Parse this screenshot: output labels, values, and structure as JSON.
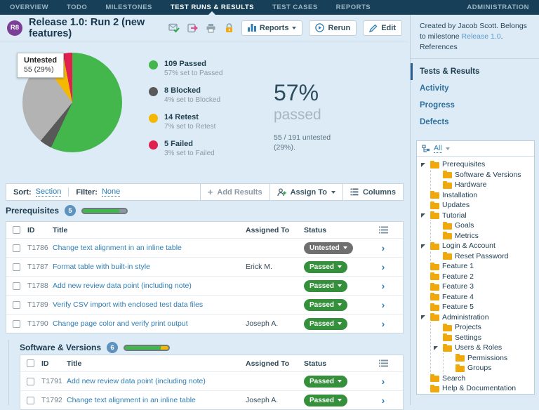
{
  "nav": {
    "items": [
      "OVERVIEW",
      "TODO",
      "MILESTONES",
      "TEST RUNS & RESULTS",
      "TEST CASES",
      "REPORTS"
    ],
    "active": "TEST RUNS & RESULTS",
    "right": "ADMINISTRATION"
  },
  "header": {
    "badge": "R8",
    "title": "Release 1.0: Run 2 (new features)",
    "reports_label": "Reports",
    "rerun_label": "Rerun",
    "edit_label": "Edit"
  },
  "chart_data": {
    "type": "pie",
    "slices": [
      {
        "label": "Passed",
        "count": 109,
        "pct": 57,
        "color": "#43b64c"
      },
      {
        "label": "Blocked",
        "count": 8,
        "pct": 4,
        "color": "#595959"
      },
      {
        "label": "Untested",
        "count": 55,
        "pct": 29,
        "color": "#b3b3b3"
      },
      {
        "label": "Retest",
        "count": 14,
        "pct": 7,
        "color": "#f5b800"
      },
      {
        "label": "Failed",
        "count": 5,
        "pct": 3,
        "color": "#e0204f"
      }
    ],
    "legend": [
      {
        "title": "109 Passed",
        "sub": "57% set to Passed",
        "color": "#43b64c"
      },
      {
        "title": "8 Blocked",
        "sub": "4% set to Blocked",
        "color": "#595959"
      },
      {
        "title": "14 Retest",
        "sub": "7% set to Retest",
        "color": "#f5b800"
      },
      {
        "title": "5 Failed",
        "sub": "3% set to Failed",
        "color": "#e0204f"
      }
    ],
    "tooltip": {
      "title": "Untested",
      "value": "55 (29%)"
    }
  },
  "summary": {
    "percent": "57%",
    "label": "passed",
    "note_line1": "55 / 191 untested",
    "note_line2": "(29%)."
  },
  "toolbar": {
    "sort_label": "Sort:",
    "sort_value": "Section",
    "filter_label": "Filter:",
    "filter_value": "None",
    "add_results": "Add Results",
    "assign_to": "Assign To",
    "columns": "Columns"
  },
  "table_columns": [
    "ID",
    "Title",
    "Assigned To",
    "Status"
  ],
  "status_colors": {
    "Passed": "#35903c",
    "Untested": "#6f6f6f"
  },
  "sections": [
    {
      "name": "Prerequisites",
      "count": "5",
      "progress": [
        {
          "color": "#43b64c",
          "pct": 84
        },
        {
          "color": "#8d969c",
          "pct": 16
        }
      ],
      "rows": [
        {
          "id": "T1786",
          "title": "Change text alignment in an inline table",
          "assigned": "",
          "status": "Untested"
        },
        {
          "id": "T1787",
          "title": "Format table with built-in style",
          "assigned": "Erick M.",
          "status": "Passed"
        },
        {
          "id": "T1788",
          "title": "Add new review data point (including note)",
          "assigned": "",
          "status": "Passed"
        },
        {
          "id": "T1789",
          "title": "Verify CSV import with enclosed test data files",
          "assigned": "",
          "status": "Passed"
        },
        {
          "id": "T1790",
          "title": "Change page color and verify print output",
          "assigned": "Joseph A.",
          "status": "Passed"
        }
      ]
    },
    {
      "name": "Software & Versions",
      "count": "6",
      "progress": [
        {
          "color": "#43b64c",
          "pct": 82
        },
        {
          "color": "#f5b800",
          "pct": 18
        }
      ],
      "rows": [
        {
          "id": "T1791",
          "title": "Add new review data point (including note)",
          "assigned": "",
          "status": "Passed"
        },
        {
          "id": "T1792",
          "title": "Change text alignment in an inline table",
          "assigned": "Joseph A.",
          "status": "Passed"
        }
      ]
    }
  ],
  "sidebar": {
    "created_prefix": "Created by Jacob Scott. Belongs to milestone ",
    "milestone_link": "Release 1.0",
    "created_suffix": ".",
    "references": "References",
    "links": [
      {
        "label": "Tests & Results",
        "active": true
      },
      {
        "label": "Activity",
        "active": false
      },
      {
        "label": "Progress",
        "active": false
      },
      {
        "label": "Defects",
        "active": false
      }
    ],
    "tree_filter": "All",
    "tree": [
      {
        "label": "Prerequisites",
        "children": [
          {
            "label": "Software & Versions"
          },
          {
            "label": "Hardware"
          }
        ]
      },
      {
        "label": "Installation"
      },
      {
        "label": "Updates"
      },
      {
        "label": "Tutorial",
        "children": [
          {
            "label": "Goals"
          },
          {
            "label": "Metrics"
          }
        ]
      },
      {
        "label": "Login & Account",
        "children": [
          {
            "label": "Reset Password"
          }
        ]
      },
      {
        "label": "Feature 1"
      },
      {
        "label": "Feature 2"
      },
      {
        "label": "Feature 3"
      },
      {
        "label": "Feature 4"
      },
      {
        "label": "Feature 5"
      },
      {
        "label": "Administration",
        "children": [
          {
            "label": "Projects"
          },
          {
            "label": "Settings"
          },
          {
            "label": "Users & Roles",
            "children": [
              {
                "label": "Permissions"
              },
              {
                "label": "Groups"
              }
            ]
          }
        ]
      },
      {
        "label": "Search"
      },
      {
        "label": "Help & Documentation"
      }
    ]
  }
}
